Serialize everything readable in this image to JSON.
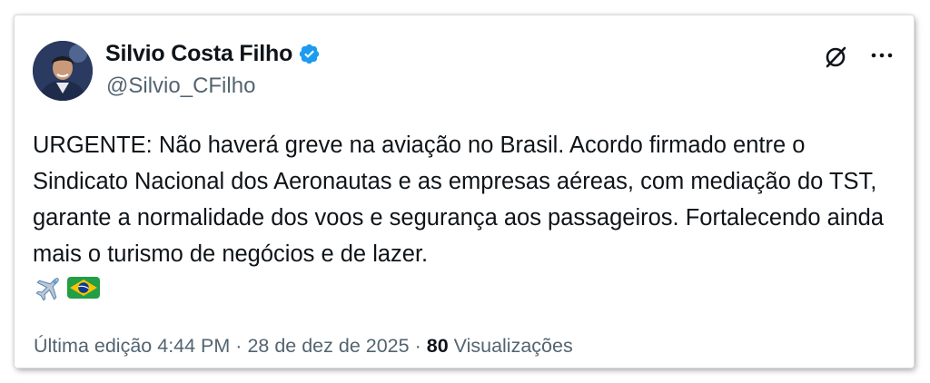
{
  "author": {
    "name": "Silvio Costa Filho",
    "handle": "@Silvio_CFilho",
    "verified": true
  },
  "tweet": {
    "text": "URGENTE: Não haverá greve na aviação no Brasil. Acordo firmado entre o Sindicato Nacional dos Aeronautas e as empresas aéreas, com mediação do TST, garante a normalidade dos voos e segurança aos passageiros. Fortalecendo ainda mais o turismo de negócios e de lazer.",
    "emojis": [
      "airplane-emoji",
      "brazil-flag-emoji"
    ]
  },
  "footer": {
    "edited_prefix": "Última edição",
    "time": "4:44 PM",
    "separator": "·",
    "date": "28 de dez de 2025",
    "views_count": "80",
    "views_label": "Visualizações"
  },
  "colors": {
    "verified_blue": "#1d9bf0",
    "text_primary": "#0f1419",
    "text_secondary": "#536471"
  },
  "icons": {
    "verified": "verified-badge-icon",
    "grok": "grok-icon",
    "more": "more-options-icon"
  }
}
